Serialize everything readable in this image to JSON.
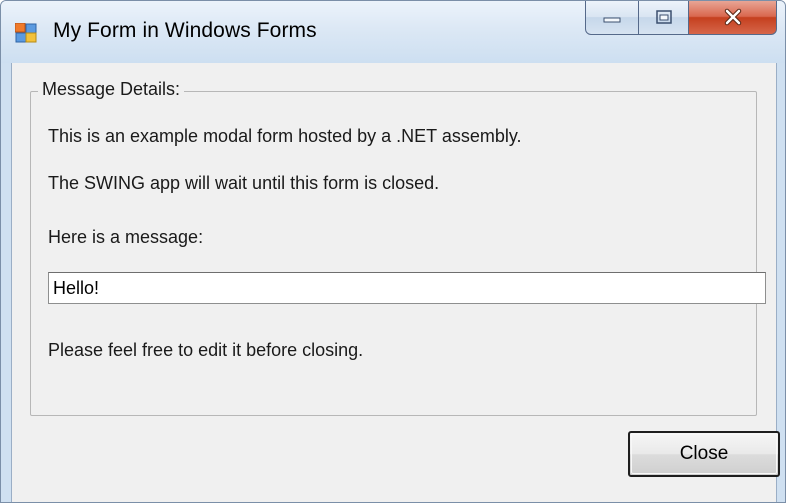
{
  "window": {
    "title": "My Form in Windows Forms",
    "icon": "windows-form-icon",
    "caption_buttons": [
      "minimize-icon",
      "maximize-icon",
      "close-icon"
    ]
  },
  "group": {
    "legend": "Message Details:",
    "line1": "This is an example modal form hosted by a .NET assembly.",
    "line2": "The SWING app will wait until this form is closed.",
    "message_label": "Here is a message:",
    "message_value": "Hello!",
    "hint": "Please feel free to edit it before closing."
  },
  "footer": {
    "close_label": "Close"
  },
  "colors": {
    "client_background": "#f0f0f0",
    "titlebar": "#dce8f5",
    "close_caption_red": "#c5401f"
  }
}
